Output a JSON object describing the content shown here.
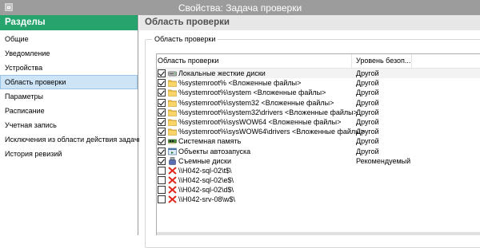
{
  "window": {
    "title": "Свойства: Задача проверки"
  },
  "sidebar": {
    "title": "Разделы",
    "items": [
      {
        "label": "Общие"
      },
      {
        "label": "Уведомление"
      },
      {
        "label": "Устройства"
      },
      {
        "label": "Область проверки",
        "active": true
      },
      {
        "label": "Параметры"
      },
      {
        "label": "Расписание"
      },
      {
        "label": "Учетная запись"
      },
      {
        "label": "Исключения из области действия задачи"
      },
      {
        "label": "История ревизий"
      }
    ]
  },
  "main": {
    "title": "Область проверки",
    "group_label": "Область проверки",
    "columns": [
      "Область проверки",
      "Уровень безоп..."
    ],
    "rows": [
      {
        "checked": true,
        "icon": "disk-icon",
        "name": "Локальные жесткие диски",
        "level": "Другой"
      },
      {
        "checked": true,
        "icon": "folder-icon",
        "name": "%systemroot% <Вложенные файлы>",
        "level": "Другой"
      },
      {
        "checked": true,
        "icon": "folder-icon",
        "name": "%systemroot%\\system <Вложенные файлы>",
        "level": "Другой"
      },
      {
        "checked": true,
        "icon": "folder-icon",
        "name": "%systemroot%\\system32 <Вложенные файлы>",
        "level": "Другой"
      },
      {
        "checked": true,
        "icon": "folder-icon",
        "name": "%systemroot%\\system32\\drivers <Вложенные файлы>",
        "level": "Другой"
      },
      {
        "checked": true,
        "icon": "folder-icon",
        "name": "%systemroot%\\sysWOW64 <Вложенные файлы>",
        "level": "Другой"
      },
      {
        "checked": true,
        "icon": "folder-icon",
        "name": "%systemroot%\\sysWOW64\\drivers <Вложенные файлы>",
        "level": "Другой"
      },
      {
        "checked": true,
        "icon": "memory-icon",
        "name": "Системная память",
        "level": "Другой"
      },
      {
        "checked": true,
        "icon": "startup-icon",
        "name": "Объекты автозапуска",
        "level": "Другой"
      },
      {
        "checked": true,
        "icon": "removable-drive-icon",
        "name": "Съемные диски",
        "level": "Рекомендуемый"
      },
      {
        "checked": false,
        "icon": "unavailable-share-icon",
        "name": "\\\\H042-sql-02\\t$\\",
        "level": ""
      },
      {
        "checked": false,
        "icon": "unavailable-share-icon",
        "name": "\\\\H042-sql-02\\e$\\",
        "level": ""
      },
      {
        "checked": false,
        "icon": "unavailable-share-icon",
        "name": "\\\\H042-sql-02\\d$\\",
        "level": ""
      },
      {
        "checked": false,
        "icon": "unavailable-share-icon",
        "name": "\\\\H042-srv-08\\w$\\",
        "level": ""
      }
    ]
  },
  "colors": {
    "sidebar_header": "#27a36d",
    "active_item": "#cde4f7",
    "titlebar": "#9c9c9c"
  }
}
